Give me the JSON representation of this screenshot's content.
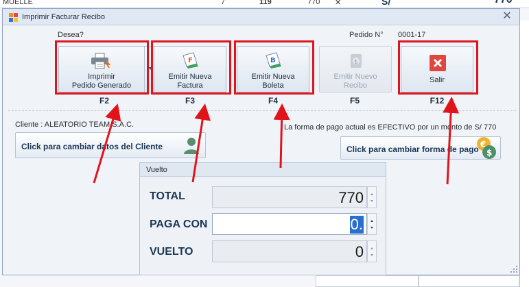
{
  "background": {
    "strip_text_left": "MUELLE",
    "strip_text_mid1": "7",
    "strip_text_mid2": "119",
    "strip_text_mid3": "770",
    "strip_text_x": "✕",
    "strip_text_currency": "S/",
    "strip_text_right": "770"
  },
  "dialog": {
    "title": "Imprimir Facturar Recibo",
    "close_icon": "close-icon"
  },
  "header": {
    "desea_label": "Desea?",
    "pedido_label": "Pedido N°",
    "pedido_number": "0001-17"
  },
  "actions": [
    {
      "id": "imprimir",
      "label_line1": "Imprimir",
      "label_line2": "Pedido Generado",
      "shortcut": "F2",
      "icon": "printer-icon",
      "enabled": true,
      "has_dropdown": true
    },
    {
      "id": "factura",
      "label_line1": "Emitir Nueva",
      "label_line2": "Factura",
      "shortcut": "F3",
      "icon": "invoice-f-icon",
      "enabled": true
    },
    {
      "id": "boleta",
      "label_line1": "Emitir Nueva",
      "label_line2": "Boleta",
      "shortcut": "F4",
      "icon": "receipt-b-icon",
      "enabled": true
    },
    {
      "id": "recibo",
      "label_line1": "Emitir Nuevo",
      "label_line2": "Recibo",
      "shortcut": "F5",
      "icon": "receipt-tag-icon",
      "enabled": false
    },
    {
      "id": "salir",
      "label_line1": "Salir",
      "label_line2": "",
      "shortcut": "F12",
      "icon": "exit-x-icon",
      "enabled": true
    }
  ],
  "cliente": {
    "label": "Cliente : ALEATORIO TEAM S.A.C.",
    "button_label": "Click para cambiar datos del Cliente",
    "icon": "user-icon"
  },
  "pago": {
    "label": "La forma de pago actual es EFECTIVO por un monto de S/  770",
    "button_label": "Click para cambiar forma de pago",
    "icon": "coins-icon"
  },
  "vuelto": {
    "title": "Vuelto",
    "rows": [
      {
        "label": "TOTAL",
        "value": "770",
        "active": false
      },
      {
        "label": "PAGA CON",
        "value": "0.",
        "active": true
      },
      {
        "label": "VUELTO",
        "value": "0",
        "active": false
      }
    ]
  },
  "colors": {
    "highlight": "#e0141b",
    "accent": "#1b3553",
    "exit_red": "#e0463e"
  }
}
